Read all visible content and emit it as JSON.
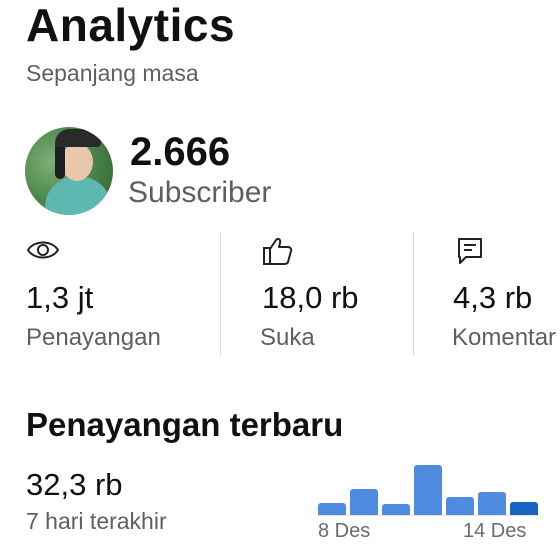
{
  "header": {
    "title": "Analytics",
    "subtitle": "Sepanjang masa"
  },
  "channel": {
    "subscriber_count": "2.666",
    "subscriber_label": "Subscriber"
  },
  "stats": [
    {
      "icon": "eye-icon",
      "value": "1,3 jt",
      "label": "Penayangan"
    },
    {
      "icon": "thumbs-up-icon",
      "value": "18,0 rb",
      "label": "Suka"
    },
    {
      "icon": "comment-icon",
      "value": "4,3 rb",
      "label": "Komentar"
    }
  ],
  "recent": {
    "title": "Penayangan terbaru",
    "value": "32,3 rb",
    "subtitle": "7 hari terakhir",
    "chart_start_label": "8 Des",
    "chart_end_label": "14 Des",
    "bar_levels": [
      0.2,
      0.43,
      0.18,
      0.83,
      0.3,
      0.38,
      0.21
    ],
    "bar_color": "#4f8ce0",
    "current_bar_color": "#1565c0"
  }
}
